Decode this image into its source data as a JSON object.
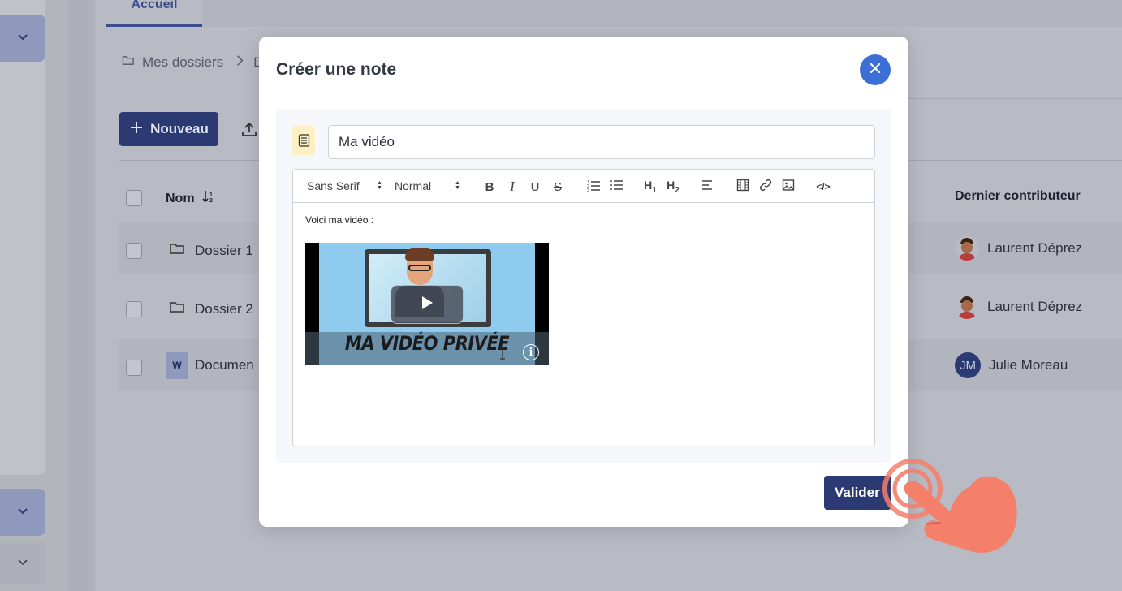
{
  "background": {
    "tab_label": "Accueil",
    "breadcrumb": {
      "root": "Mes dossiers",
      "next": "D"
    },
    "new_button_label": "Nouveau",
    "table": {
      "headers": {
        "name": "Nom",
        "contributor": "Dernier contributeur"
      },
      "rows": [
        {
          "name": "Dossier 1",
          "type": "folder",
          "contributor": "Laurent Déprez"
        },
        {
          "name": "Dossier 2",
          "type": "folder",
          "contributor": "Laurent Déprez"
        },
        {
          "name": "Documen",
          "type": "word",
          "type_badge": "W",
          "contributor": "Julie Moreau",
          "contributor_initials": "JM"
        }
      ]
    }
  },
  "modal": {
    "title": "Créer une note",
    "note_title_value": "Ma vidéo",
    "editor": {
      "font_family": "Sans Serif",
      "font_size": "Normal",
      "heading1": "H",
      "heading1_sub": "1",
      "heading2": "H",
      "heading2_sub": "2",
      "code_label": "</>",
      "content_text": "Voici ma vidéo :",
      "video": {
        "caption": "MA VIDÉO PRIVÉE",
        "info_label": "i"
      }
    },
    "validate_label": "Valider"
  },
  "colors": {
    "primary": "#2b3a73",
    "close_button": "#3d6ed6",
    "hand": "#f47f6b"
  }
}
